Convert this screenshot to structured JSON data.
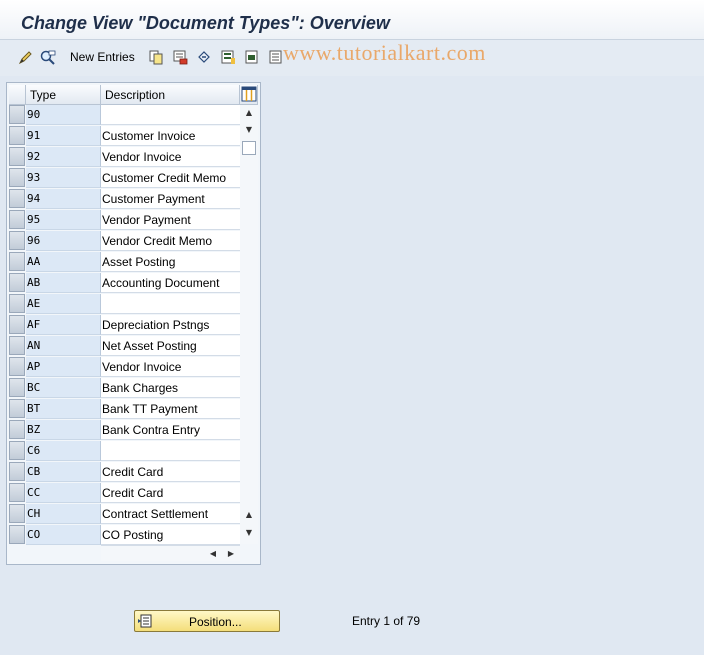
{
  "window": {
    "title": "Change View \"Document Types\": Overview"
  },
  "toolbar": {
    "new_entries_label": "New Entries",
    "icons": [
      "pencil-glasses-icon",
      "display-change-icon",
      "copy-icon",
      "delete-icon",
      "undo-icon",
      "select-all-icon",
      "select-block-icon",
      "deselect-all-icon"
    ]
  },
  "watermark": {
    "text": "www.tutorialkart.com"
  },
  "table": {
    "columns": [
      "Type",
      "Description"
    ],
    "rows": [
      {
        "type": "90",
        "description": ""
      },
      {
        "type": "91",
        "description": "Customer Invoice"
      },
      {
        "type": "92",
        "description": "Vendor Invoice"
      },
      {
        "type": "93",
        "description": "Customer Credit Memo"
      },
      {
        "type": "94",
        "description": "Customer Payment"
      },
      {
        "type": "95",
        "description": "Vendor Payment"
      },
      {
        "type": "96",
        "description": "Vendor Credit Memo"
      },
      {
        "type": "AA",
        "description": "Asset Posting"
      },
      {
        "type": "AB",
        "description": "Accounting Document"
      },
      {
        "type": "AE",
        "description": ""
      },
      {
        "type": "AF",
        "description": "Depreciation Pstngs"
      },
      {
        "type": "AN",
        "description": "Net Asset Posting"
      },
      {
        "type": "AP",
        "description": "Vendor Invoice"
      },
      {
        "type": "BC",
        "description": "Bank Charges"
      },
      {
        "type": "BT",
        "description": "Bank TT Payment"
      },
      {
        "type": "BZ",
        "description": "Bank Contra Entry"
      },
      {
        "type": "C6",
        "description": ""
      },
      {
        "type": "CB",
        "description": "Credit Card"
      },
      {
        "type": "CC",
        "description": "Credit Card"
      },
      {
        "type": "CH",
        "description": "Contract Settlement"
      },
      {
        "type": "CO",
        "description": "CO Posting"
      }
    ]
  },
  "footer": {
    "position_button_label": "Position...",
    "entry_text": "Entry 1 of 79"
  },
  "colors": {
    "watermark": "#e9a86a",
    "key_column_bg": "#dce8f6",
    "position_button": "#f4de7a"
  }
}
